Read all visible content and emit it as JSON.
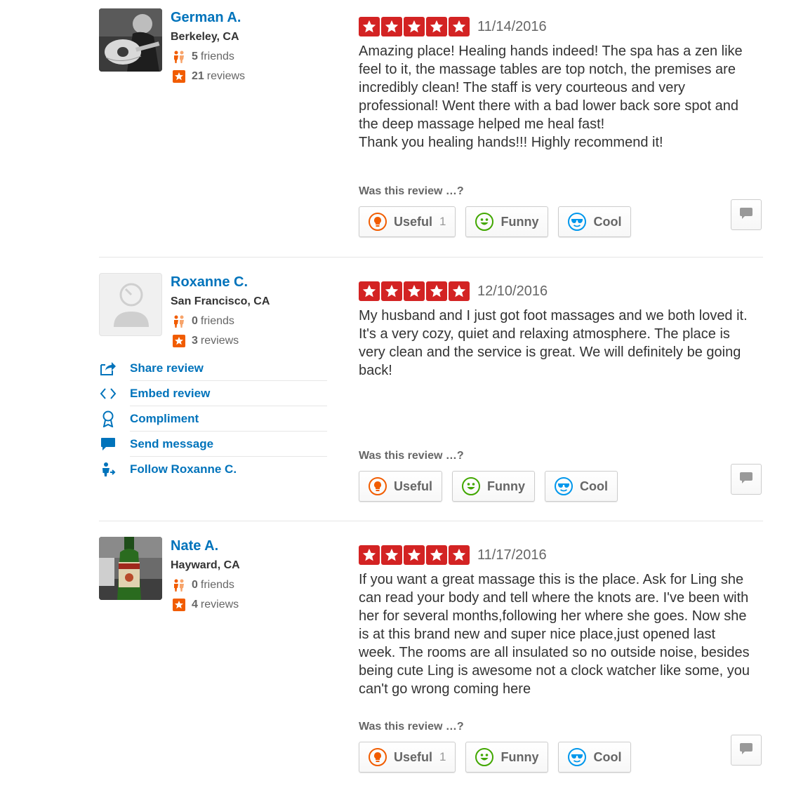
{
  "colors": {
    "accent": "#0073bb",
    "star_red": "#d32323",
    "orange": "#f15c00"
  },
  "feedback_question": "Was this review …?",
  "vote_labels": {
    "useful": "Useful",
    "funny": "Funny",
    "cool": "Cool"
  },
  "reviews": [
    {
      "user": {
        "name": "German A.",
        "location": "Berkeley, CA",
        "friends_count": "5",
        "friends_label": "friends",
        "reviews_count": "21",
        "reviews_label": "reviews"
      },
      "rating": 5,
      "date": "11/14/2016",
      "text": "Amazing place!  Healing hands indeed!  The spa has a zen like feel to it, the massage tables are top notch, the premises are incredibly clean!  The staff is very courteous and very professional!  Went there with a bad lower back sore spot and the deep massage helped me heal fast!\n Thank you healing hands!!!  Highly recommend it!",
      "useful_count": "1",
      "funny_count": "",
      "cool_count": ""
    },
    {
      "user": {
        "name": "Roxanne C.",
        "location": "San Francisco, CA",
        "friends_count": "0",
        "friends_label": "friends",
        "reviews_count": "3",
        "reviews_label": "reviews"
      },
      "rating": 5,
      "date": "12/10/2016",
      "text": "My husband and I just got foot massages and we both loved it. It's a very cozy, quiet and relaxing atmosphere. The place is very clean and the service is great. We will definitely be going back!",
      "useful_count": "",
      "funny_count": "",
      "cool_count": "",
      "actions": [
        {
          "icon": "share-icon",
          "label": "Share review"
        },
        {
          "icon": "embed-icon",
          "label": "Embed review"
        },
        {
          "icon": "compliment-icon",
          "label": "Compliment"
        },
        {
          "icon": "message-icon",
          "label": "Send message"
        },
        {
          "icon": "follow-icon",
          "label": "Follow Roxanne C."
        }
      ]
    },
    {
      "user": {
        "name": "Nate A.",
        "location": "Hayward, CA",
        "friends_count": "0",
        "friends_label": "friends",
        "reviews_count": "4",
        "reviews_label": "reviews"
      },
      "rating": 5,
      "date": "11/17/2016",
      "text": "If you want a great massage this is the place. Ask for Ling she can read your body and tell where the knots are. I've been with her for several months,following her where she goes. Now she is at this brand new and super nice place,just opened last week. The rooms are all insulated so no outside noise, besides being cute Ling is awesome not a clock watcher like some, you can't go wrong coming here",
      "useful_count": "1",
      "funny_count": "",
      "cool_count": ""
    }
  ]
}
